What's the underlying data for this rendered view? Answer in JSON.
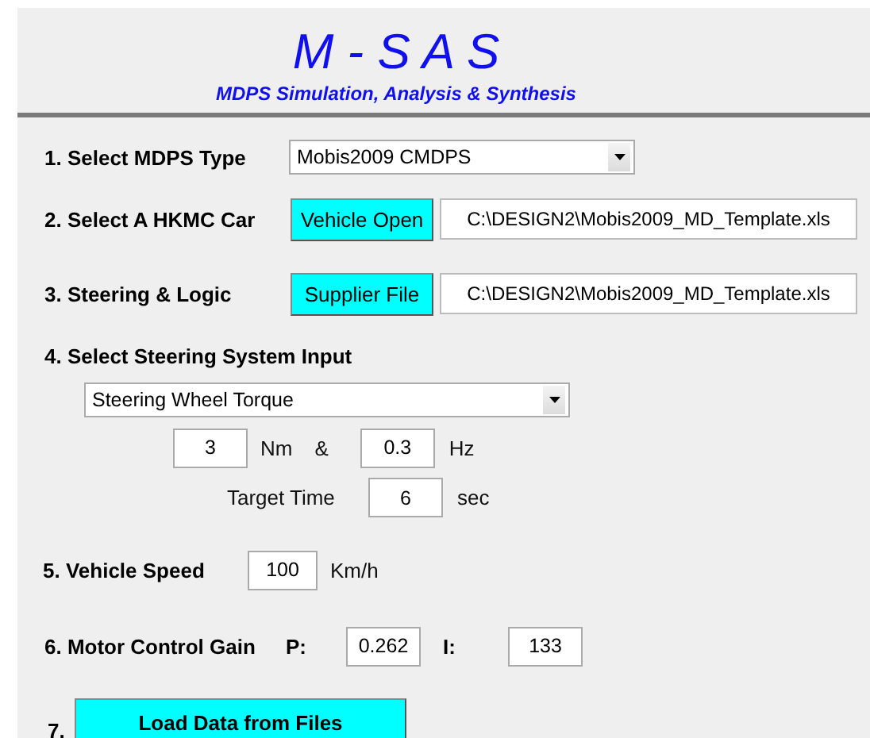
{
  "header": {
    "title": "M - S A S",
    "subtitle": "MDPS Simulation, Analysis & Synthesis"
  },
  "mdps_type": {
    "label": "1. Select MDPS Type",
    "value": "Mobis2009 CMDPS"
  },
  "car": {
    "label": "2. Select A HKMC Car",
    "button": "Vehicle Open",
    "path": "C:\\DESIGN2\\Mobis2009_MD_Template.xls"
  },
  "steering_logic": {
    "label": "3. Steering & Logic",
    "button": "Supplier File",
    "path": "C:\\DESIGN2\\Mobis2009_MD_Template.xls"
  },
  "steering_input": {
    "label": "4. Select Steering System Input",
    "value": "Steering Wheel Torque",
    "amplitude": "3",
    "amplitude_unit": "Nm",
    "joiner": "&",
    "frequency": "0.3",
    "frequency_unit": "Hz",
    "target_time_label": "Target Time",
    "target_time": "6",
    "target_time_unit": "sec"
  },
  "vehicle_speed": {
    "label": "5. Vehicle Speed",
    "value": "100",
    "unit": "Km/h"
  },
  "motor_gain": {
    "label": "6. Motor Control Gain",
    "p_label": "P:",
    "p": "0.262",
    "i_label": "I:",
    "i": "133"
  },
  "load": {
    "label": "7.",
    "button": "Load Data from Files"
  }
}
